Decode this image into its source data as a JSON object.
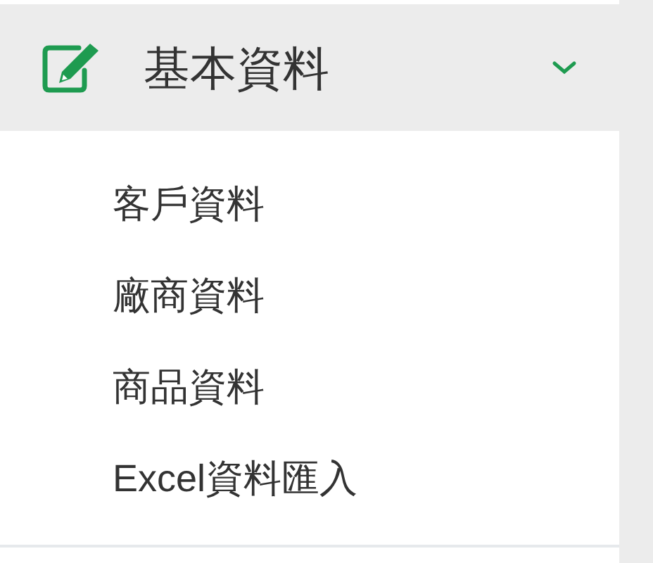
{
  "menu": {
    "title": "基本資料",
    "expanded": true,
    "items": [
      {
        "label": "客戶資料"
      },
      {
        "label": "廠商資料"
      },
      {
        "label": "商品資料"
      },
      {
        "label": "Excel資料匯入"
      }
    ]
  }
}
